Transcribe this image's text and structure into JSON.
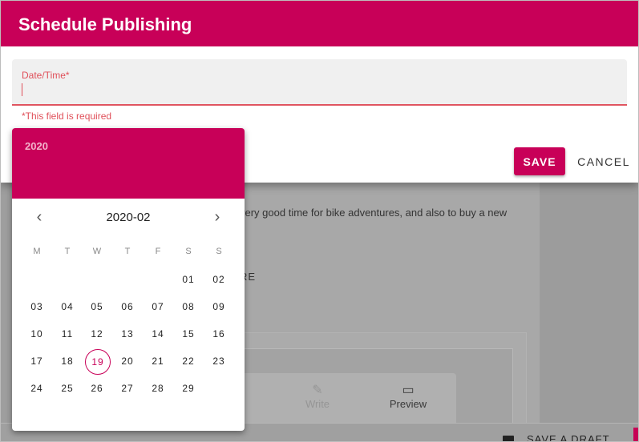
{
  "dialog": {
    "title": "Schedule Publishing",
    "field_label": "Date/Time*",
    "field_value": "",
    "error": "*This field is required",
    "save_label": "SAVE",
    "cancel_label": "CANCEL"
  },
  "picker": {
    "year": "2020",
    "month_label": "2020-02",
    "prev_icon": "chevron-left-icon",
    "next_icon": "chevron-right-icon",
    "weekdays": [
      "M",
      "T",
      "W",
      "T",
      "F",
      "S",
      "S"
    ],
    "weeks": [
      [
        "",
        "",
        "",
        "",
        "",
        "01",
        "02"
      ],
      [
        "03",
        "04",
        "05",
        "06",
        "07",
        "08",
        "09"
      ],
      [
        "10",
        "11",
        "12",
        "13",
        "14",
        "15",
        "16"
      ],
      [
        "17",
        "18",
        "19",
        "20",
        "21",
        "22",
        "23"
      ],
      [
        "24",
        "25",
        "26",
        "27",
        "28",
        "29",
        ""
      ]
    ],
    "today": "19"
  },
  "background": {
    "text": "very good time for bike adventures, and also to buy a new",
    "more": "RE",
    "write_tab": "Write",
    "preview_tab": "Preview",
    "save_draft": "SAVE A DRAFT"
  },
  "colors": {
    "accent": "#c80058",
    "error": "#e0505a"
  }
}
